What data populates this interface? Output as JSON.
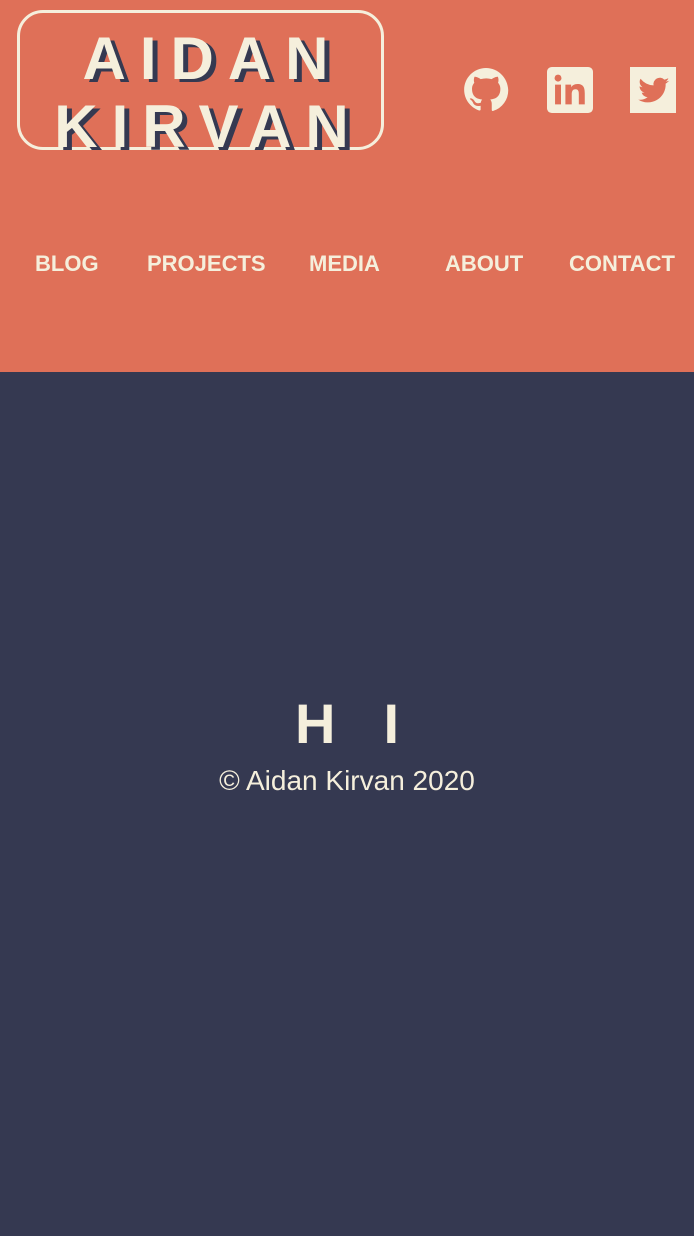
{
  "brand": {
    "line1": "AIDAN",
    "line2": "KIRVAN"
  },
  "social": [
    {
      "name": "github",
      "icon": "github-icon"
    },
    {
      "name": "linkedin",
      "icon": "linkedin-icon"
    },
    {
      "name": "twitter",
      "icon": "twitter-icon"
    }
  ],
  "nav": {
    "blog": "BLOG",
    "projects": "PROJECTS",
    "media": "MEDIA",
    "about": "ABOUT",
    "contact": "CONTACT"
  },
  "main": {
    "greeting": "HI"
  },
  "footer": {
    "copyright": "© Aidan Kirvan 2020"
  },
  "colors": {
    "header_bg": "#df7058",
    "body_bg": "#353951",
    "cream": "#f5efdc"
  }
}
